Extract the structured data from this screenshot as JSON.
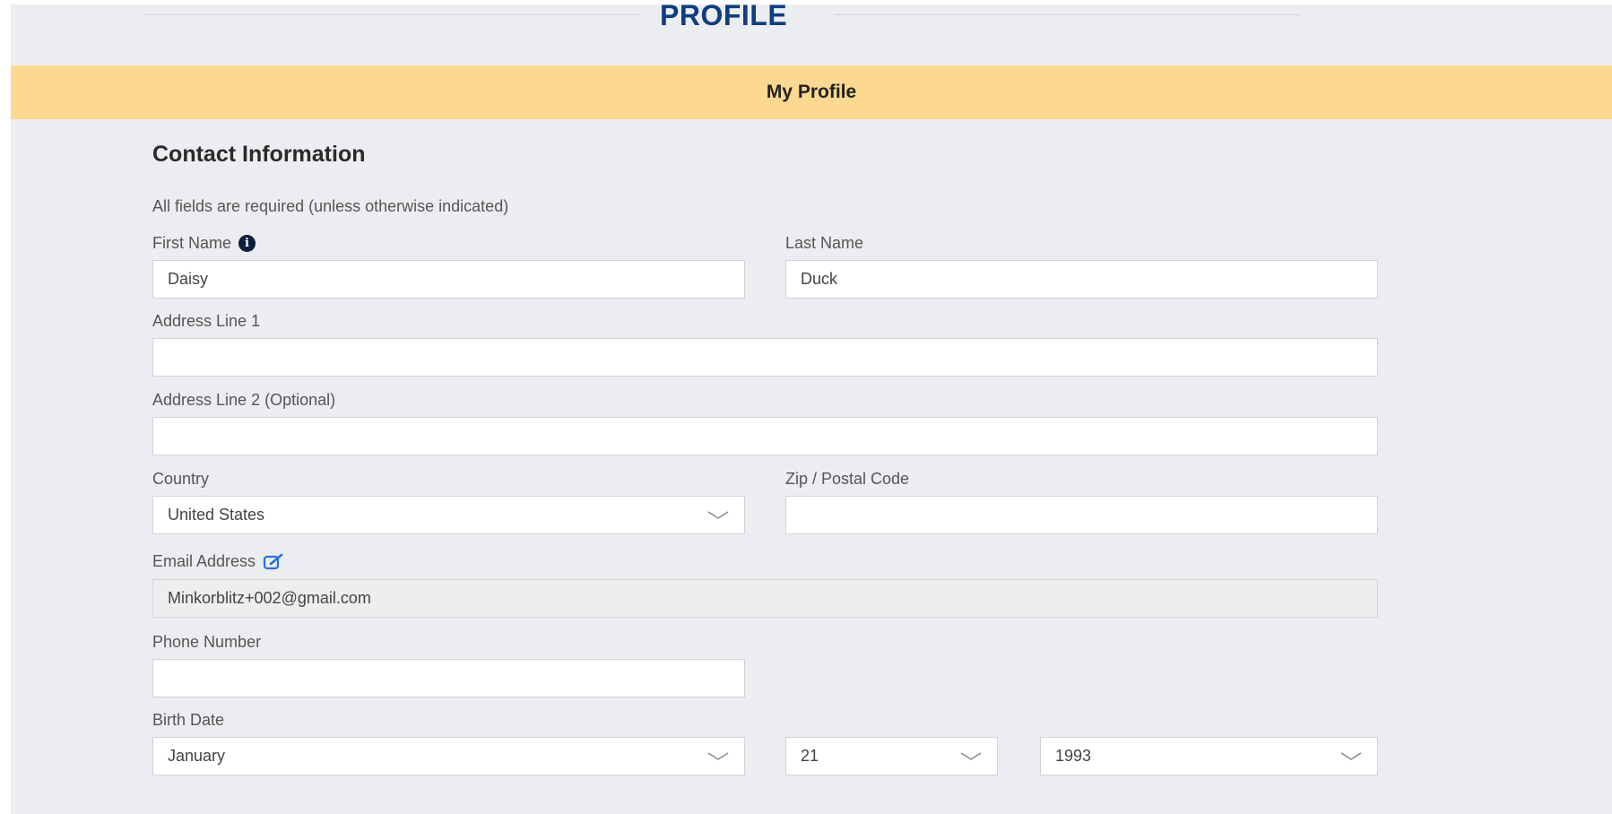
{
  "header": {
    "title": "PROFILE"
  },
  "banner": {
    "label": "My Profile"
  },
  "section": {
    "title": "Contact Information",
    "note": "All fields are required (unless otherwise indicated)"
  },
  "fields": {
    "first_name": {
      "label": "First Name",
      "value": "Daisy",
      "icon": "info-icon"
    },
    "last_name": {
      "label": "Last Name",
      "value": "Duck"
    },
    "address1": {
      "label": "Address Line 1",
      "value": ""
    },
    "address2": {
      "label": "Address Line 2 (Optional)",
      "value": ""
    },
    "country": {
      "label": "Country",
      "value": "United States"
    },
    "zip": {
      "label": "Zip / Postal Code",
      "value": ""
    },
    "email": {
      "label": "Email Address",
      "value": "Minkorblitz+002@gmail.com",
      "icon": "edit-icon"
    },
    "phone": {
      "label": "Phone Number",
      "value": ""
    },
    "birth": {
      "label": "Birth Date",
      "month": "January",
      "day": "21",
      "year": "1993"
    }
  },
  "colors": {
    "banner": "#fdd890",
    "title": "#0e3e7e",
    "background": "#ecedf0"
  }
}
